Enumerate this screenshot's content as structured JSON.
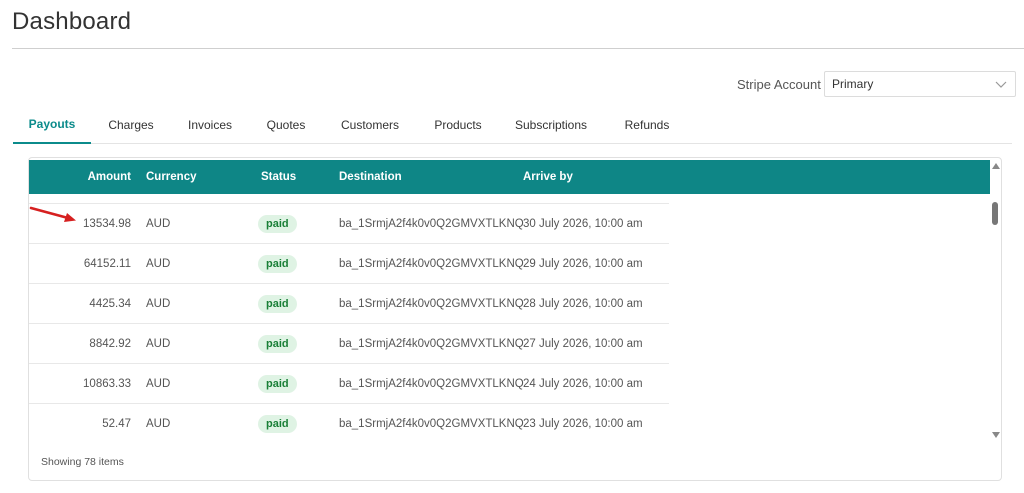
{
  "page": {
    "title": "Dashboard"
  },
  "account": {
    "label": "Stripe Account",
    "selected": "Primary"
  },
  "tabs": [
    {
      "label": "Payouts",
      "active": true
    },
    {
      "label": "Charges"
    },
    {
      "label": "Invoices"
    },
    {
      "label": "Quotes"
    },
    {
      "label": "Customers"
    },
    {
      "label": "Products"
    },
    {
      "label": "Subscriptions"
    },
    {
      "label": "Refunds"
    }
  ],
  "grid": {
    "columns": [
      "Amount",
      "Currency",
      "Status",
      "Destination",
      "Arrive by"
    ],
    "rows": [
      {
        "amount": "13534.98",
        "currency": "AUD",
        "status": "paid",
        "destination": "ba_1SrmjA2f4k0v0Q2GMVXTLKNQ",
        "arrive_by": "30 July 2026, 10:00 am"
      },
      {
        "amount": "64152.11",
        "currency": "AUD",
        "status": "paid",
        "destination": "ba_1SrmjA2f4k0v0Q2GMVXTLKNQ",
        "arrive_by": "29 July 2026, 10:00 am"
      },
      {
        "amount": "4425.34",
        "currency": "AUD",
        "status": "paid",
        "destination": "ba_1SrmjA2f4k0v0Q2GMVXTLKNQ",
        "arrive_by": "28 July 2026, 10:00 am"
      },
      {
        "amount": "8842.92",
        "currency": "AUD",
        "status": "paid",
        "destination": "ba_1SrmjA2f4k0v0Q2GMVXTLKNQ",
        "arrive_by": "27 July 2026, 10:00 am"
      },
      {
        "amount": "10863.33",
        "currency": "AUD",
        "status": "paid",
        "destination": "ba_1SrmjA2f4k0v0Q2GMVXTLKNQ",
        "arrive_by": "24 July 2026, 10:00 am"
      },
      {
        "amount": "52.47",
        "currency": "AUD",
        "status": "paid",
        "destination": "ba_1SrmjA2f4k0v0Q2GMVXTLKNQ",
        "arrive_by": "23 July 2026, 10:00 am"
      }
    ],
    "footer": "Showing 78 items"
  },
  "colors": {
    "accent": "#0e8686",
    "badge_bg": "#dff3e4",
    "badge_text": "#1a7f37",
    "annotation_arrow": "#d62020"
  },
  "icons": {
    "select": "chevron-down-icon",
    "scroll_up": "scroll-up-arrow-icon",
    "scroll_down": "scroll-down-arrow-icon",
    "annotation": "red-arrow-icon"
  }
}
